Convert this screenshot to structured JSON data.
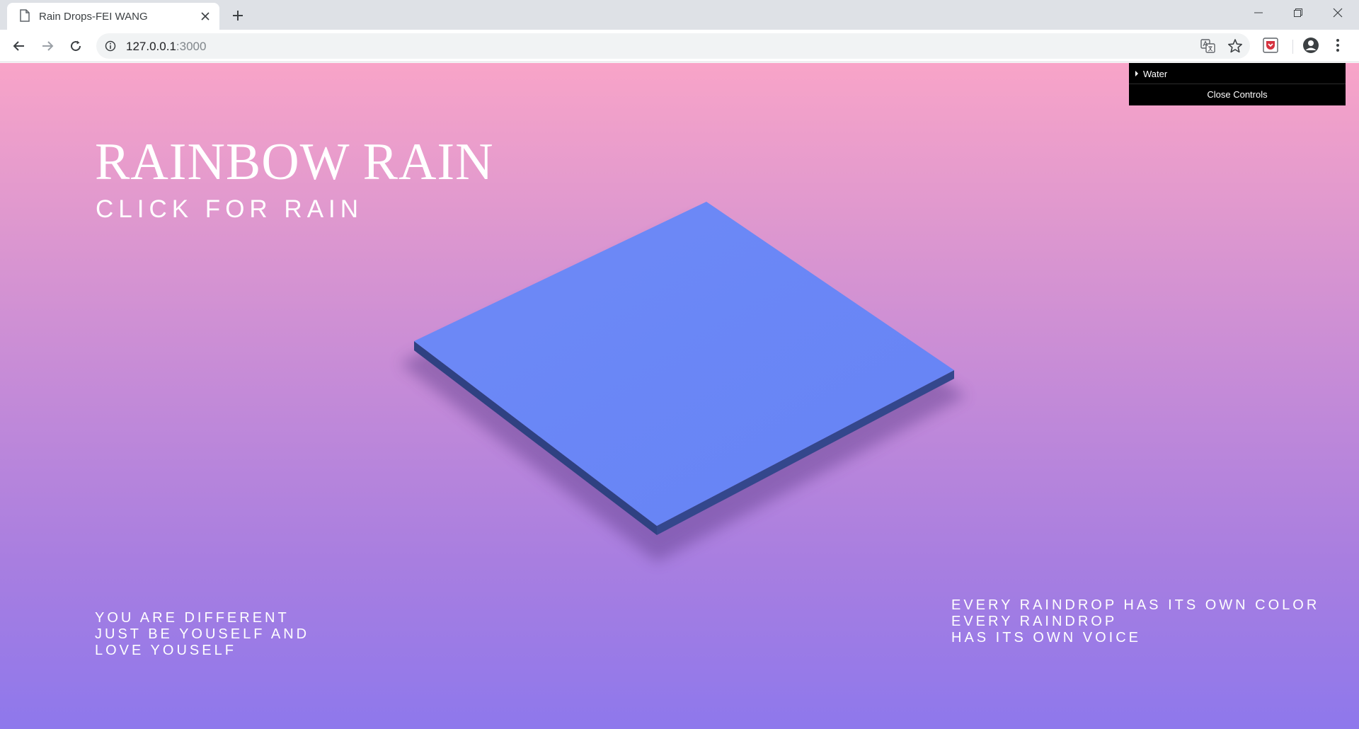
{
  "browser": {
    "tab": {
      "title": "Rain Drops-FEI WANG"
    },
    "address": {
      "host": "127.0.0.1",
      "port": ":3000"
    }
  },
  "page": {
    "title": "RAINBOW RAIN",
    "subtitle": "CLICK FOR RAIN",
    "quote_left": [
      "YOU ARE DIFFERENT",
      "JUST BE YOUSELF AND",
      "LOVE YOUSELF"
    ],
    "quote_right": [
      "EVERY RAINDROP HAS ITS OWN COLOR",
      "EVERY RAINDROP",
      "HAS ITS OWN VOICE"
    ],
    "background_colors": [
      "#f8a4c8",
      "#8e78ec"
    ],
    "water_tile_color": "#6a86f6"
  },
  "gui": {
    "folder_label": "Water",
    "close_label": "Close Controls"
  }
}
